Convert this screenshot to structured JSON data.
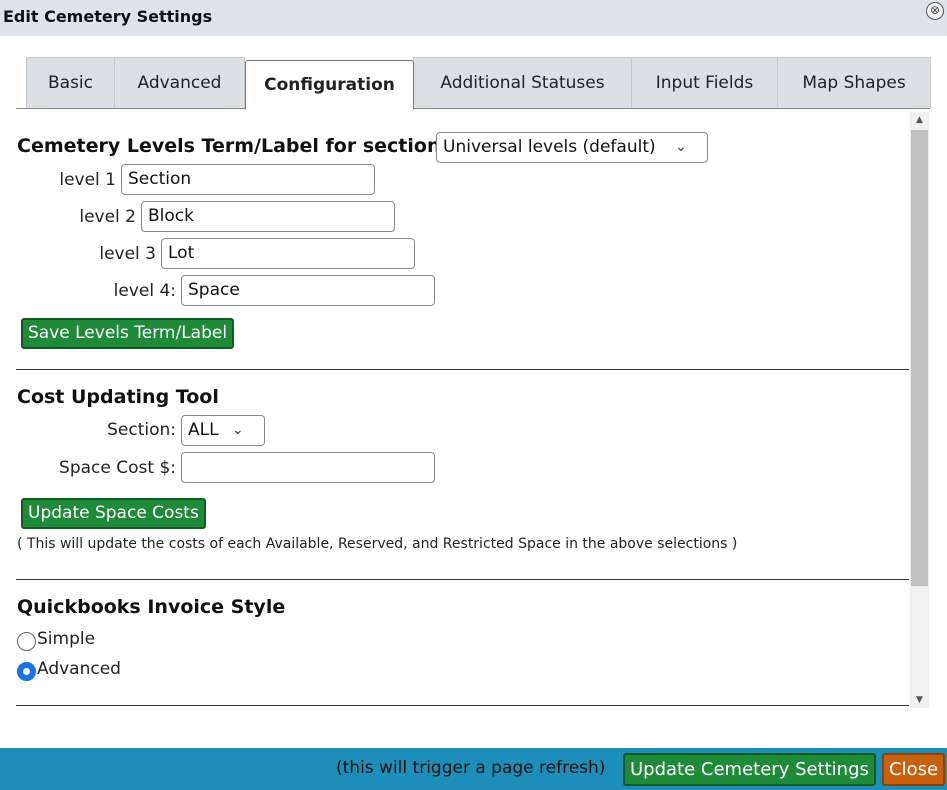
{
  "dialog": {
    "title": "Edit Cemetery Settings",
    "close_icon": "⊗"
  },
  "tabs": [
    {
      "label": "Basic",
      "active": false
    },
    {
      "label": "Advanced",
      "active": false
    },
    {
      "label": "Configuration",
      "active": true
    },
    {
      "label": "Additional Statuses",
      "active": false
    },
    {
      "label": "Input Fields",
      "active": false
    },
    {
      "label": "Map Shapes",
      "active": false
    }
  ],
  "levels": {
    "title": "Cemetery Levels Term/Label for section",
    "section_select": "Universal levels (default)",
    "fields": [
      {
        "label": "level 1",
        "value": "Section"
      },
      {
        "label": "level 2",
        "value": "Block"
      },
      {
        "label": "level 3",
        "value": "Lot"
      },
      {
        "label": "level 4:",
        "value": "Space"
      }
    ],
    "save_button": "Save Levels Term/Label"
  },
  "cost_tool": {
    "title": "Cost Updating Tool",
    "section_label": "Section:",
    "section_value": "ALL",
    "space_cost_label": "Space Cost $:",
    "space_cost_value": "",
    "update_button": "Update Space Costs",
    "note": "( This will update the costs of each Available, Reserved, and Restricted Space in the above selections )"
  },
  "quickbooks": {
    "title": "Quickbooks Invoice Style",
    "options": [
      {
        "label": "Simple",
        "checked": false
      },
      {
        "label": "Advanced",
        "checked": true
      }
    ]
  },
  "footer": {
    "note": "(this will trigger a page refresh)",
    "update_button": "Update Cemetery Settings",
    "close_button": "Close"
  },
  "colors": {
    "accent_green": "#1f8a3a",
    "footer_blue": "#1d8eb8",
    "close_orange": "#c7610f",
    "radio_blue": "#1a73e8"
  }
}
